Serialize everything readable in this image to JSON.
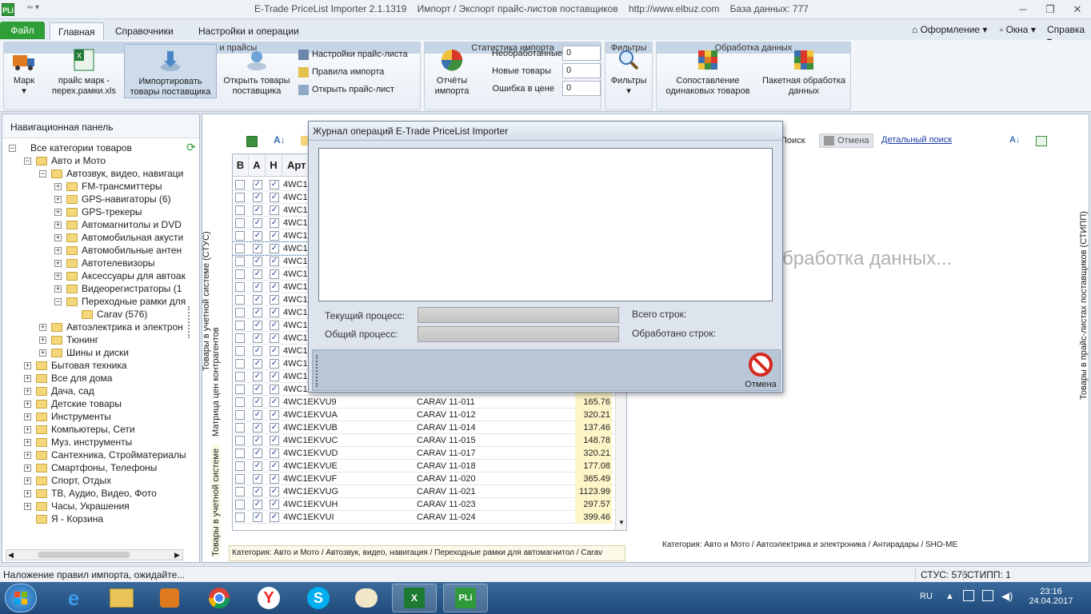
{
  "window": {
    "title": "E-Trade PriceList Importer 2.1.1319    Импорт / Экспорт прайс-листов поставщиков    http://www.elbuz.com    База данных: 777",
    "icon": "PLi"
  },
  "menu": {
    "file": "Файл",
    "tabs": [
      "Главная",
      "Справочники",
      "Настройки и операции"
    ],
    "right": [
      "Оформление",
      "Окна",
      "Справка"
    ]
  },
  "ribbon": {
    "group1": {
      "caption": "Поставщики и прайсы",
      "buttons": [
        "Марк",
        "прайс марк - перех.рамки.xls",
        "Импортировать товары поставщика",
        "Открыть товары поставщика"
      ],
      "links": [
        "Настройки прайс-листа",
        "Правила импорта",
        "Открыть прайс-лист"
      ]
    },
    "group2": {
      "caption": "Статистика импорта",
      "button": "Отчёты импорта",
      "stats": [
        {
          "label": "Необработанные",
          "value": "0"
        },
        {
          "label": "Новые товары",
          "value": "0"
        },
        {
          "label": "Ошибка в цене",
          "value": "0"
        }
      ]
    },
    "group3": {
      "caption": "Фильтры",
      "button": "Фильтры"
    },
    "group4": {
      "caption": "Обработка данных",
      "buttons": [
        "Сопоставление одинаковых товаров",
        "Пакетная обработка данных"
      ]
    }
  },
  "nav": {
    "title": "Навигационная панель",
    "items": [
      {
        "label": "Все категории товаров",
        "level": 0,
        "exp": "−",
        "folder": false
      },
      {
        "label": "Авто и Мото",
        "level": 1,
        "exp": "−",
        "folder": true
      },
      {
        "label": "Автозвук, видео, навигаци",
        "level": 2,
        "exp": "−",
        "folder": true
      },
      {
        "label": "FM-трансмиттеры",
        "level": 3,
        "exp": "+",
        "folder": true
      },
      {
        "label": "GPS-навигаторы (6)",
        "level": 3,
        "exp": "+",
        "folder": true
      },
      {
        "label": "GPS-трекеры",
        "level": 3,
        "exp": "+",
        "folder": true
      },
      {
        "label": "Автомагнитолы и DVD",
        "level": 3,
        "exp": "+",
        "folder": true
      },
      {
        "label": "Автомобильная акусти",
        "level": 3,
        "exp": "+",
        "folder": true
      },
      {
        "label": "Автомобильные антен",
        "level": 3,
        "exp": "+",
        "folder": true
      },
      {
        "label": "Автотелевизоры",
        "level": 3,
        "exp": "+",
        "folder": true
      },
      {
        "label": "Аксессуары для автоак",
        "level": 3,
        "exp": "+",
        "folder": true
      },
      {
        "label": "Видеорегистраторы (1",
        "level": 3,
        "exp": "+",
        "folder": true
      },
      {
        "label": "Переходные рамки для",
        "level": 3,
        "exp": "−",
        "folder": true
      },
      {
        "label": "Carav (576)",
        "level": 4,
        "exp": "",
        "folder": true
      },
      {
        "label": "Автоэлектрика и электрон",
        "level": 2,
        "exp": "+",
        "folder": true
      },
      {
        "label": "Тюнинг",
        "level": 2,
        "exp": "+",
        "folder": true
      },
      {
        "label": "Шины и диски",
        "level": 2,
        "exp": "+",
        "folder": true
      },
      {
        "label": "Бытовая техника",
        "level": 1,
        "exp": "+",
        "folder": true
      },
      {
        "label": "Все для дома",
        "level": 1,
        "exp": "+",
        "folder": true
      },
      {
        "label": "Дача, сад",
        "level": 1,
        "exp": "+",
        "folder": true
      },
      {
        "label": "Детские товары",
        "level": 1,
        "exp": "+",
        "folder": true
      },
      {
        "label": "Инструменты",
        "level": 1,
        "exp": "+",
        "folder": true
      },
      {
        "label": "Компьютеры, Сети",
        "level": 1,
        "exp": "+",
        "folder": true
      },
      {
        "label": "Муз. инструменты",
        "level": 1,
        "exp": "+",
        "folder": true
      },
      {
        "label": "Сантехника, Стройматериалы",
        "level": 1,
        "exp": "+",
        "folder": true
      },
      {
        "label": "Смартфоны, Телефоны",
        "level": 1,
        "exp": "+",
        "folder": true
      },
      {
        "label": "Спорт, Отдых",
        "level": 1,
        "exp": "+",
        "folder": true
      },
      {
        "label": "ТВ, Аудио, Видео, Фото",
        "level": 1,
        "exp": "+",
        "folder": true
      },
      {
        "label": "Часы, Украшения",
        "level": 1,
        "exp": "+",
        "folder": true
      },
      {
        "label": "Я - Корзина",
        "level": 1,
        "exp": "",
        "folder": true
      }
    ]
  },
  "side_tabs": {
    "left1": "Товары в учетной системе (СТУС)",
    "left2": "Матрица цен контрагентов",
    "left3": "Товары в учетной системе",
    "right": "Товары в прайс-листах поставщиков (СТИПП)"
  },
  "grid": {
    "headers": [
      "В",
      "А",
      "Н",
      "Арт"
    ],
    "rows": [
      {
        "art": "4WC1E",
        "name": "",
        "price": ""
      },
      {
        "art": "4WC1E",
        "name": "",
        "price": ""
      },
      {
        "art": "4WC1E",
        "name": "",
        "price": ""
      },
      {
        "art": "4WC1E",
        "name": "",
        "price": ""
      },
      {
        "art": "4WC1E",
        "name": "",
        "price": ""
      },
      {
        "art": "4WC1E",
        "name": "",
        "price": ""
      },
      {
        "art": "4WC1E",
        "name": "",
        "price": ""
      },
      {
        "art": "4WC1E",
        "name": "",
        "price": ""
      },
      {
        "art": "4WC1E",
        "name": "",
        "price": ""
      },
      {
        "art": "4WC1E",
        "name": "",
        "price": ""
      },
      {
        "art": "4WC1E",
        "name": "",
        "price": ""
      },
      {
        "art": "4WC1E",
        "name": "",
        "price": ""
      },
      {
        "art": "4WC1E",
        "name": "",
        "price": ""
      },
      {
        "art": "4WC1E",
        "name": "",
        "price": ""
      },
      {
        "art": "4WC1E",
        "name": "",
        "price": ""
      },
      {
        "art": "4WC1E",
        "name": "",
        "price": ""
      },
      {
        "art": "4WC1E",
        "name": "",
        "price": ""
      },
      {
        "art": "4WC1EKVU9",
        "name": "CARAV 11-011",
        "price": "165.76"
      },
      {
        "art": "4WC1EKVUA",
        "name": "CARAV 11-012",
        "price": "320.21"
      },
      {
        "art": "4WC1EKVUB",
        "name": "CARAV 11-014",
        "price": "137.46"
      },
      {
        "art": "4WC1EKVUC",
        "name": "CARAV 11-015",
        "price": "148.78"
      },
      {
        "art": "4WC1EKVUD",
        "name": "CARAV 11-017",
        "price": "320.21"
      },
      {
        "art": "4WC1EKVUE",
        "name": "CARAV 11-018",
        "price": "177.08"
      },
      {
        "art": "4WC1EKVUF",
        "name": "CARAV 11-020",
        "price": "365.49"
      },
      {
        "art": "4WC1EKVUG",
        "name": "CARAV 11-021",
        "price": "1123.99"
      },
      {
        "art": "4WC1EKVUH",
        "name": "CARAV 11-023",
        "price": "297.57"
      },
      {
        "art": "4WC1EKVUI",
        "name": "CARAV 11-024",
        "price": "399.46"
      }
    ],
    "category": "Категория: Авто и Мото / Автозвук, видео, навигация / Переходные рамки для автомагнитол / Carav"
  },
  "right_panel": {
    "search": "Поиск",
    "cancel": "Отмена",
    "detail_search": "Детальный поиск",
    "overlay": "бработка данных...",
    "category": "Категория: Авто и Мото / Автоэлектрика и электроника / Антирадары / SHO-ME"
  },
  "dialog": {
    "title": "Журнал операций E-Trade PriceList Importer",
    "current": "Текущий процесс:",
    "total": "Общий процесс:",
    "rows_all": "Всего строк:",
    "rows_done": "Обработано строк:",
    "cancel": "Отмена"
  },
  "status": {
    "left": "Наложение правил импорта, ожидайте...",
    "stus": "СТУС: 576",
    "stipp": "СТИПП: 1"
  },
  "taskbar": {
    "lang": "RU",
    "time": "23:16",
    "date": "24.04.2017"
  }
}
